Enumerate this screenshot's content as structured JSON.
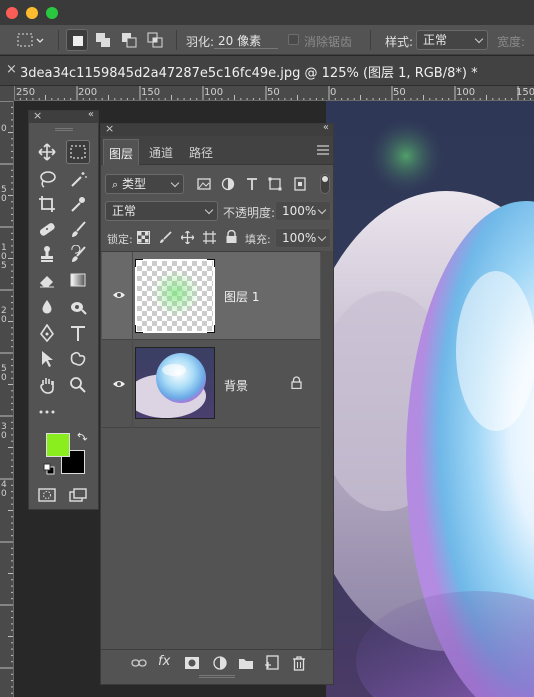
{
  "window": {
    "doc_tab_title": "3dea34c1159845d2a47287e5c16fc49e.jpg @ 125% (图层 1, RGB/8*) *",
    "doc_tab_close": "×"
  },
  "options_bar": {
    "feather_label": "羽化:",
    "feather_value": "20 像素",
    "antialias_label": "消除锯齿",
    "style_label": "样式:",
    "style_value": "正常",
    "width_label": "宽度:"
  },
  "ruler": {
    "top_ticks": [
      "250",
      "200",
      "150",
      "100",
      "50",
      "0",
      "50",
      "100",
      "150"
    ],
    "left_ticks": [
      "0",
      "5",
      "0",
      "1",
      "0",
      "5",
      "0",
      "2",
      "0",
      "5",
      "0",
      "3",
      "0",
      "5",
      "0",
      "4",
      "0",
      "5",
      "0"
    ]
  },
  "layers_panel": {
    "tabs": [
      "图层",
      "通道",
      "路径"
    ],
    "filter_label": "类型",
    "blend_mode": "正常",
    "opacity_label": "不透明度:",
    "opacity_value": "100%",
    "lock_label": "锁定:",
    "fill_label": "填充:",
    "fill_value": "100%",
    "layers": [
      {
        "name": "图层 1",
        "visible": true,
        "selected": true
      },
      {
        "name": "背景",
        "visible": true,
        "selected": false,
        "locked": true
      }
    ],
    "bottom_fx": "fx"
  },
  "tools": {
    "foreground_color": "#8aee1e",
    "background_color": "#000000"
  },
  "colors": {
    "accent_close": "#fc5e57",
    "accent_min": "#fdbc2e",
    "accent_max": "#29c840"
  }
}
